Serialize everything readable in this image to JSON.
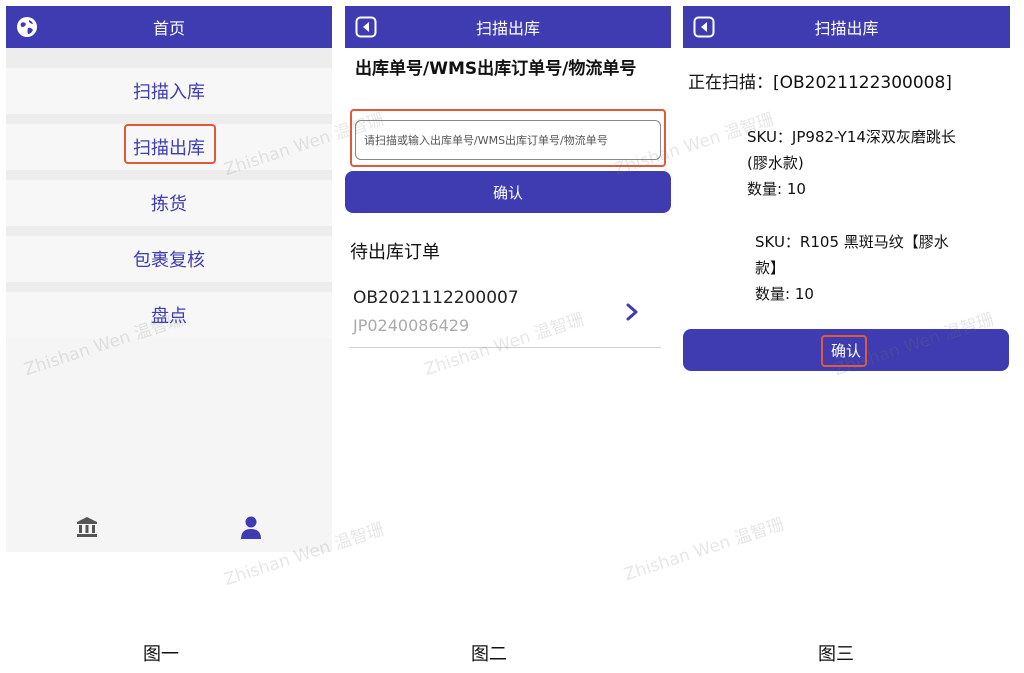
{
  "panel1": {
    "header_title": "首页",
    "menu": [
      "扫描入库",
      "扫描出库",
      "拣货",
      "包裹复核",
      "盘点"
    ]
  },
  "panel2": {
    "header_title": "扫描出库",
    "field_label": "出库单号/WMS出库订单号/物流单号",
    "input_placeholder": "请扫描或输入出库单号/WMS出库订单号/物流单号",
    "confirm_label": "确认",
    "section_title": "待出库订单",
    "order": {
      "id": "OB2021112200007",
      "sub": "JP0240086429"
    }
  },
  "panel3": {
    "header_title": "扫描出库",
    "scanning_line": "正在扫描：[OB2021122300008]",
    "sku1": {
      "line1": "SKU：JP982-Y14深双灰磨跳长",
      "line2": "(膠水款)",
      "qty": "数量: 10"
    },
    "sku2": {
      "line1": "SKU：R105 黑斑马纹【膠水",
      "line2": "款】",
      "qty": "数量: 10"
    },
    "confirm_label": "确认"
  },
  "captions": [
    "图一",
    "图二",
    "图三"
  ],
  "watermark": "Zhishan Wen 温智珊",
  "colors": {
    "primary": "#3f3bb0",
    "highlight": "#e05a3a"
  },
  "icons": [
    "globe-icon",
    "back-icon",
    "bank-icon",
    "user-icon",
    "chevron-right-icon"
  ]
}
